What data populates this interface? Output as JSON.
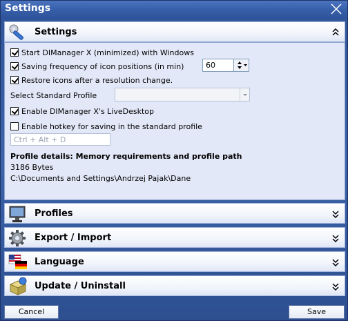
{
  "window": {
    "title": "Settings"
  },
  "sections": {
    "settings": {
      "label": "Settings"
    },
    "profiles": {
      "label": "Profiles"
    },
    "export_import": {
      "label": "Export / Import"
    },
    "language": {
      "label": "Language"
    },
    "update_uninstall": {
      "label": "Update / Uninstall"
    }
  },
  "options": {
    "start_minimized": {
      "label": "Start DIManager X (minimized) with Windows",
      "checked": true
    },
    "saving_frequency": {
      "label": "Saving frequency of icon positions (in min)",
      "checked": true,
      "value": "60"
    },
    "restore_icons": {
      "label": "Restore icons after a resolution change.",
      "checked": true
    },
    "standard_profile": {
      "label": "Select Standard Profile",
      "value": ""
    },
    "livedesktop": {
      "label": "Enable DIManager X's LiveDesktop",
      "checked": true
    },
    "hotkey": {
      "label": "Enable hotkey for saving in the standard profile",
      "checked": false,
      "placeholder": "Ctrl + Alt + D"
    }
  },
  "profile_details": {
    "title": "Profile details: Memory requirements and profile path",
    "size": "3186 Bytes",
    "path": "C:\\Documents and Settings\\Andrzej Pajak\\Dane"
  },
  "buttons": {
    "cancel": "Cancel",
    "save": "Save"
  },
  "icons": {
    "close": "close-icon",
    "settings": "wrench-icon",
    "profiles": "monitor-icon",
    "export_import": "gear-icon",
    "language": "flags-icon",
    "update_uninstall": "package-icon"
  }
}
